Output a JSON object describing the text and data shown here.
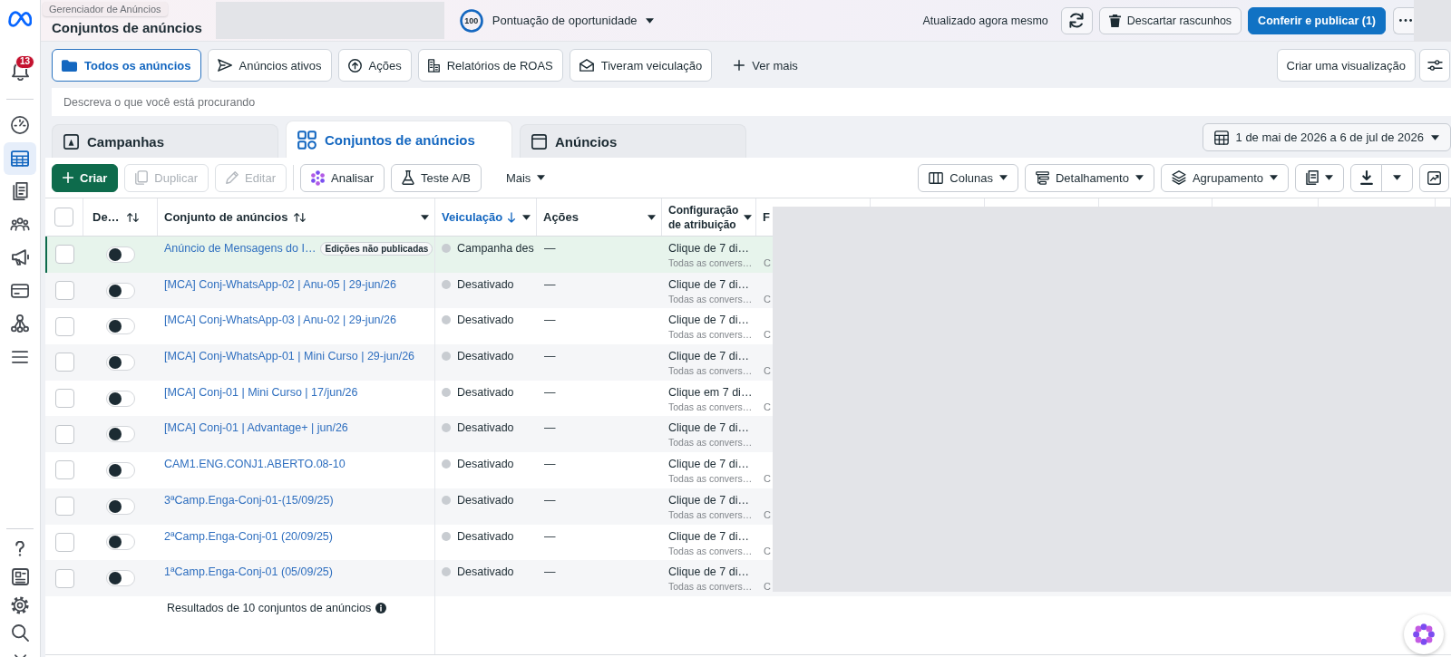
{
  "sidebar": {
    "notification_count": "13",
    "items": [
      {
        "selected": false
      },
      {
        "selected": true
      },
      {
        "selected": false
      },
      {
        "selected": false
      },
      {
        "selected": false
      },
      {
        "selected": false
      },
      {
        "selected": false
      },
      {
        "selected": false
      }
    ]
  },
  "header": {
    "tooltip": "Gerenciador de Anúncios",
    "title": "Conjuntos de anúncios",
    "opportunity_score": {
      "value": "100",
      "label": "Pontuação de oportunidade"
    },
    "status": "Atualizado agora mesmo",
    "actions": [
      {
        "kind": "icon"
      },
      {
        "kind": "secondary",
        "label": "Descartar rascunhos"
      },
      {
        "kind": "primary",
        "label": "Conferir e publicar (1)"
      },
      {
        "kind": "icon"
      }
    ]
  },
  "views": {
    "items": [
      {
        "label": "Todos os anúncios",
        "selected": true
      },
      {
        "label": "Anúncios ativos",
        "selected": false
      },
      {
        "label": "Ações",
        "selected": false
      },
      {
        "label": "Relatórios de ROAS",
        "selected": false
      },
      {
        "label": "Tiveram veiculação",
        "selected": false
      }
    ],
    "more": "Ver mais",
    "create": "Criar uma visualização"
  },
  "search": {
    "placeholder": "Descreva o que você está procurando"
  },
  "level_tabs": [
    {
      "label": "Campanhas",
      "selected": false
    },
    {
      "label": "Conjuntos de anúncios",
      "selected": true
    },
    {
      "label": "Anúncios",
      "selected": false
    }
  ],
  "date_range": "1 de mai de 2026 a 6 de jul de 2026",
  "toolbar": {
    "left": [
      {
        "kind": "primary",
        "label": "Criar",
        "disabled": false
      },
      {
        "kind": "button",
        "label": "Duplicar",
        "disabled": true
      },
      {
        "kind": "button",
        "label": "Editar",
        "disabled": true
      },
      {
        "kind": "button",
        "label": "Analisar",
        "disabled": false
      },
      {
        "kind": "button",
        "label": "Teste A/B",
        "disabled": false
      },
      {
        "kind": "menu",
        "label": "Mais",
        "disabled": false
      }
    ],
    "right": [
      {
        "kind": "menu",
        "label": "Colunas"
      },
      {
        "kind": "menu",
        "label": "Detalhamento"
      },
      {
        "kind": "menu",
        "label": "Agrupamento"
      },
      {
        "kind": "icon-menu"
      },
      {
        "kind": "split"
      },
      {
        "kind": "icon"
      }
    ]
  },
  "table": {
    "select_all": {
      "checked": false
    },
    "columns": [
      {
        "label": "De…",
        "sortable": true,
        "sorted": false,
        "menu": false
      },
      {
        "label": "Conjunto de anúncios",
        "sortable": true,
        "sorted": false,
        "menu": true
      },
      {
        "label": "Veiculação",
        "sortable": true,
        "sorted": true,
        "menu": true
      },
      {
        "label": "Ações",
        "sortable": false,
        "sorted": false,
        "menu": true
      },
      {
        "label": "Configuração de atribuição",
        "sortable": false,
        "sorted": false,
        "menu": true
      },
      {
        "label": "F",
        "sortable": false,
        "sorted": false,
        "menu": false
      }
    ],
    "rows": [
      {
        "checked": false,
        "on": false,
        "highlighted": true,
        "name": "Anúncio de Mensagens do I…",
        "badge": "Edições não publicadas",
        "delivery": "Campanha des",
        "actions": "—",
        "attribution": "Clique de 7 di…",
        "attribution_detail": "Todas as convers…",
        "column_6": "C"
      },
      {
        "checked": false,
        "on": false,
        "highlighted": false,
        "name": "[MCA] Conj-WhatsApp-02 | Anu-05 | 29-jun/26",
        "delivery": "Desativado",
        "actions": "—",
        "attribution": "Clique de 7 di…",
        "attribution_detail": "Todas as convers…",
        "column_6": "C"
      },
      {
        "checked": false,
        "on": false,
        "highlighted": false,
        "name": "[MCA] Conj-WhatsApp-03 | Anu-02 | 29-jun/26",
        "delivery": "Desativado",
        "actions": "—",
        "attribution": "Clique de 7 di…",
        "attribution_detail": "Todas as convers…",
        "column_6": "C"
      },
      {
        "checked": false,
        "on": false,
        "highlighted": false,
        "name": "[MCA] Conj-WhatsApp-01 | Mini Curso | 29-jun/26",
        "delivery": "Desativado",
        "actions": "—",
        "attribution": "Clique de 7 di…",
        "attribution_detail": "Todas as convers…",
        "column_6": "C"
      },
      {
        "checked": false,
        "on": false,
        "highlighted": false,
        "name": "[MCA] Conj-01 | Mini Curso | 17/jun/26",
        "delivery": "Desativado",
        "actions": "—",
        "attribution": "Clique em 7 di…",
        "attribution_detail": "Todas as convers…",
        "column_6": "C"
      },
      {
        "checked": false,
        "on": false,
        "highlighted": false,
        "name": "[MCA] Conj-01 | Advantage+ | jun/26",
        "delivery": "Desativado",
        "actions": "—",
        "attribution": "Clique de 7 di…",
        "attribution_detail": "Todas as convers…"
      },
      {
        "checked": false,
        "on": false,
        "highlighted": false,
        "name": "CAM1.ENG.CONJ1.ABERTO.08-10",
        "delivery": "Desativado",
        "actions": "—",
        "attribution": "Clique de 7 di…",
        "attribution_detail": "Todas as convers…",
        "column_6": "C"
      },
      {
        "checked": false,
        "on": false,
        "highlighted": false,
        "name": "3ªCamp.Enga-Conj-01-(15/09/25)",
        "delivery": "Desativado",
        "actions": "—",
        "attribution": "Clique de 7 di…",
        "attribution_detail": "Todas as convers…",
        "column_6": "C"
      },
      {
        "checked": false,
        "on": false,
        "highlighted": false,
        "name": "2ªCamp.Enga-Conj-01 (20/09/25)",
        "delivery": "Desativado",
        "actions": "—",
        "attribution": "Clique de 7 di…",
        "attribution_detail": "Todas as convers…",
        "column_6": "C"
      },
      {
        "checked": false,
        "on": false,
        "highlighted": false,
        "name": "1ªCamp.Enga-Conj-01 (05/09/25)",
        "delivery": "Desativado",
        "actions": "—",
        "attribution": "Clique de 7 di…",
        "attribution_detail": "Todas as convers…",
        "column_6": "C"
      }
    ],
    "footer": "Resultados de 10 conjuntos de anúncios"
  }
}
